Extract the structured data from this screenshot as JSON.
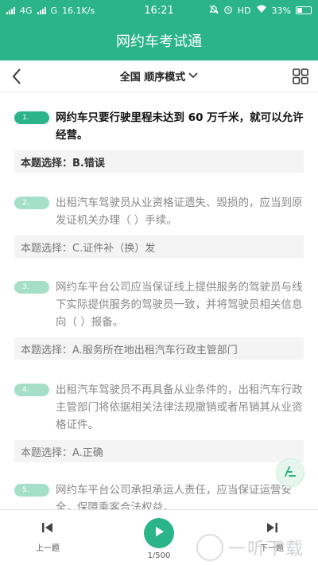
{
  "status_bar": {
    "carrier_signal_1": "4G",
    "carrier_signal_2": "G",
    "net_speed": "16.1K/s",
    "time": "16:21",
    "hd_label": "HD",
    "battery": "33%"
  },
  "app": {
    "title": "网约车考试通"
  },
  "nav": {
    "mode_label": "全国 顺序模式"
  },
  "questions": [
    {
      "number": "1.",
      "text": "网约车只要行驶里程未达到 60 万千米，就可以允许经营。",
      "answer": "本题选择：B.错误"
    },
    {
      "number": "2.",
      "text": "出租汽车驾驶员从业资格证遗失、毁损的，应当到原发证机关办理（ ）手续。",
      "answer": "本题选择：C.证件补（换）发"
    },
    {
      "number": "3.",
      "text": "网约车平台公司应当保证线上提供服务的驾驶员与线下实际提供服务的驾驶员一致，并将驾驶员相关信息向（ ）报备。",
      "answer": "本题选择：A.服务所在地出租汽车行政主管部门"
    },
    {
      "number": "4.",
      "text": "出租汽车驾驶员不再具备从业条件的，出租汽车行政主管部门将依据相关法律法规撤销或者吊销其从业资格证件。",
      "answer": "本题选择：A.正确"
    },
    {
      "number": "5.",
      "text": "网约车平台公司承担承运人责任，应当保证运营安全，保障乘客合法权益。",
      "answer": ""
    }
  ],
  "bottom": {
    "prev_label": "上一题",
    "next_label": "下一题",
    "progress": "1/500"
  },
  "watermark": {
    "text": "一听下载"
  },
  "colors": {
    "primary": "#2bb389",
    "badge_active": "#2bb389",
    "badge_inactive": "#a6dfc9"
  },
  "icons": [
    "back-icon",
    "grid-icon",
    "chevron-down-icon",
    "prev-icon",
    "play-icon",
    "next-icon",
    "edit-icon"
  ]
}
